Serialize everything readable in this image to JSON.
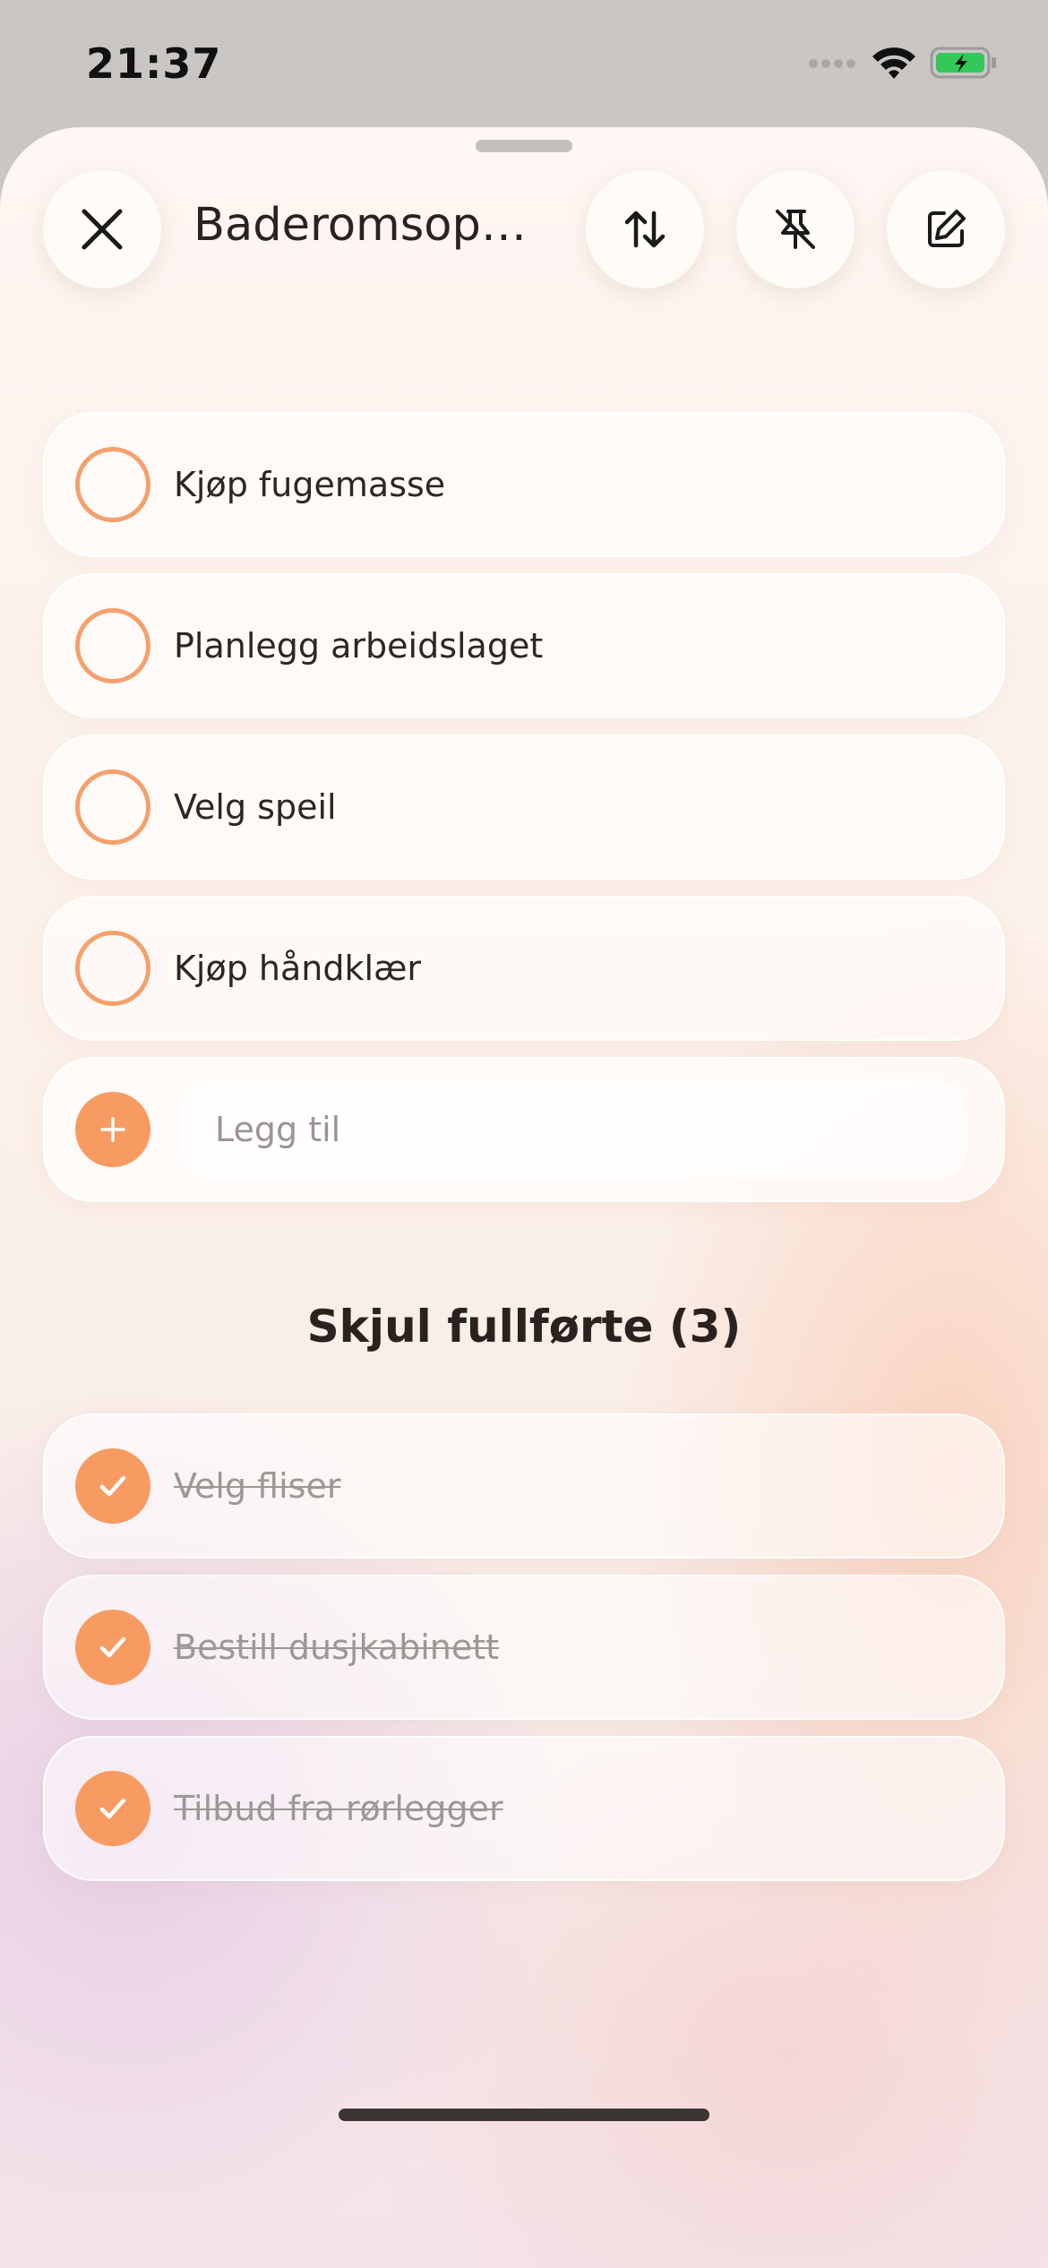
{
  "status_bar": {
    "time": "21:37",
    "icons": [
      "signal-icon",
      "wifi-icon",
      "battery-charging-icon"
    ],
    "battery_color": "#34c759"
  },
  "header": {
    "title": "Baderomsoppu…",
    "close_icon": "close-icon",
    "sort_icon": "sort-arrows-icon",
    "unpin_icon": "pin-off-icon",
    "edit_icon": "edit-icon"
  },
  "todo_items": [
    {
      "label": "Kjøp fugemasse",
      "completed": false
    },
    {
      "label": "Planlegg arbeidslaget",
      "completed": false
    },
    {
      "label": "Velg speil",
      "completed": false
    },
    {
      "label": "Kjøp håndklær",
      "completed": false
    }
  ],
  "add_item": {
    "placeholder": "Legg til",
    "icon": "plus-icon"
  },
  "completed_section": {
    "toggle_label": "Skjul fullførte (3)"
  },
  "completed_items": [
    {
      "label": "Velg fliser",
      "completed": true
    },
    {
      "label": "Bestill dusjkabinett",
      "completed": true
    },
    {
      "label": "Tilbud fra rørlegger",
      "completed": true
    }
  ],
  "colors": {
    "accent": "#f89b62",
    "text": "#2b221f"
  }
}
